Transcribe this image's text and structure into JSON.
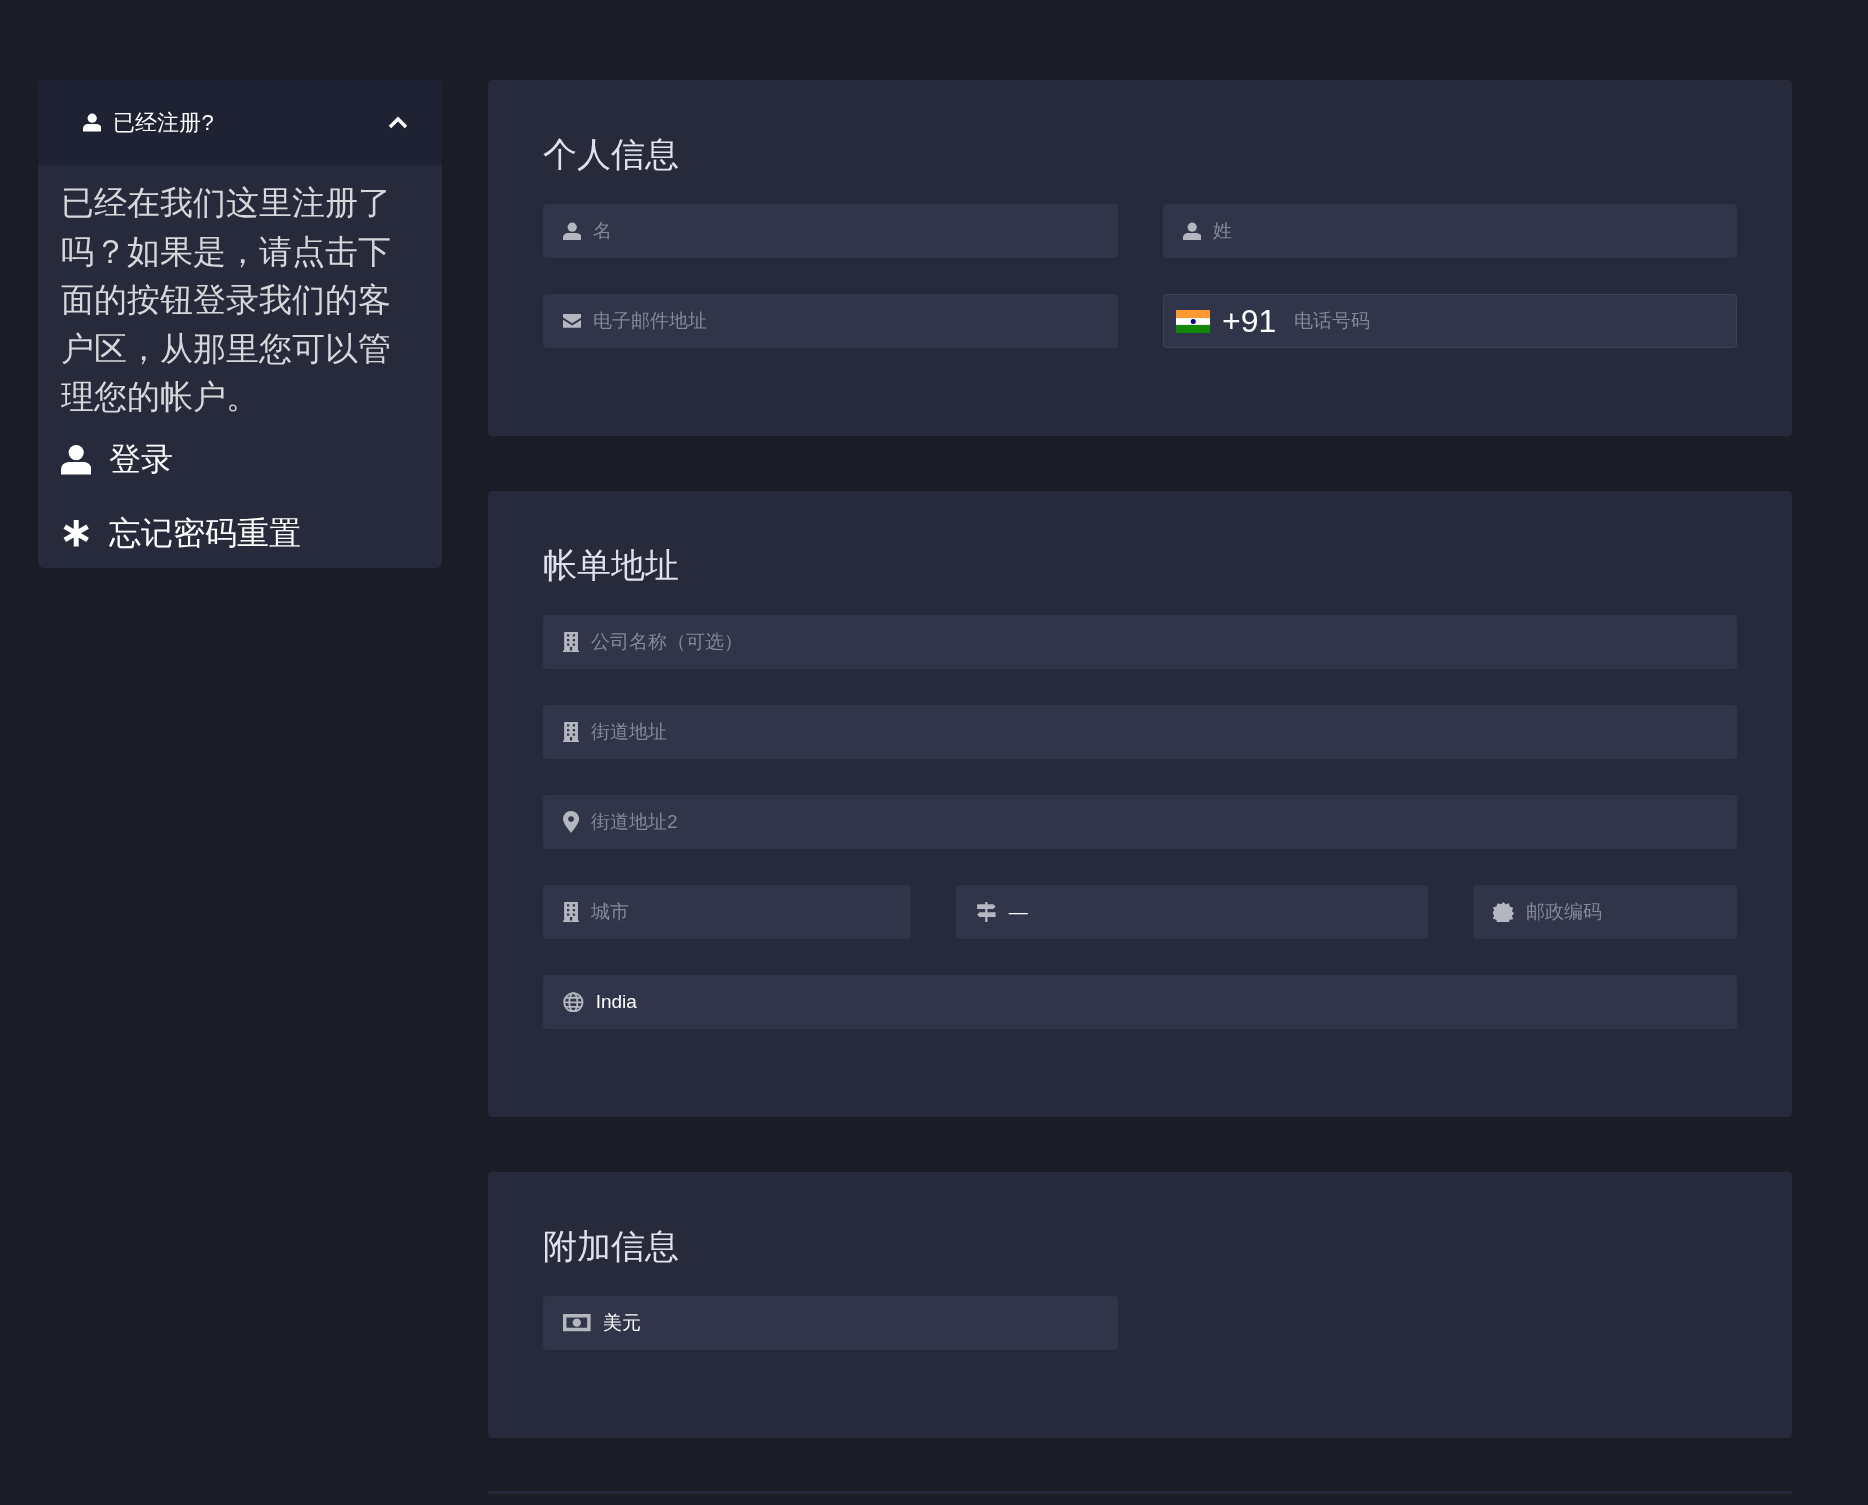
{
  "sidebar": {
    "header": {
      "title": "已经注册?",
      "expanded": true
    },
    "text": "已经在我们这里注册了吗？如果是，请点击下面的按钮登录我们的客户区，从那里您可以管理您的帐户。",
    "links": [
      {
        "kind": "user",
        "label": "登录"
      },
      {
        "kind": "asterisk",
        "label": "忘记密码重置"
      }
    ]
  },
  "sections": [
    {
      "title": "个人信息",
      "rows": [
        {
          "kind": "pair",
          "fields": [
            {
              "kind": "user",
              "placeholder": "名"
            },
            {
              "kind": "user",
              "placeholder": "姓"
            }
          ]
        },
        {
          "kind": "pair",
          "fields": [
            {
              "kind": "email",
              "placeholder": "电子邮件地址"
            },
            {
              "kind": "phone",
              "dial_code": "+91",
              "placeholder": "电话号码"
            }
          ]
        }
      ]
    },
    {
      "title": "帐单地址",
      "rows": [
        {
          "kind": "single",
          "fields": [
            {
              "kind": "company",
              "placeholder": "公司名称（可选）"
            }
          ]
        },
        {
          "kind": "single",
          "fields": [
            {
              "kind": "address",
              "placeholder": "街道地址"
            }
          ]
        },
        {
          "kind": "single",
          "fields": [
            {
              "kind": "address2",
              "placeholder": "街道地址2"
            }
          ]
        },
        {
          "kind": "triple",
          "fields": [
            {
              "kind": "city",
              "placeholder": "城市"
            },
            {
              "kind": "state",
              "value": "—"
            },
            {
              "kind": "postcode",
              "placeholder": "邮政编码"
            }
          ]
        },
        {
          "kind": "single",
          "fields": [
            {
              "kind": "country",
              "value": "India"
            }
          ]
        }
      ]
    },
    {
      "title": "附加信息",
      "rows": [
        {
          "kind": "half",
          "fields": [
            {
              "kind": "currency",
              "value": "美元"
            }
          ]
        }
      ]
    }
  ]
}
